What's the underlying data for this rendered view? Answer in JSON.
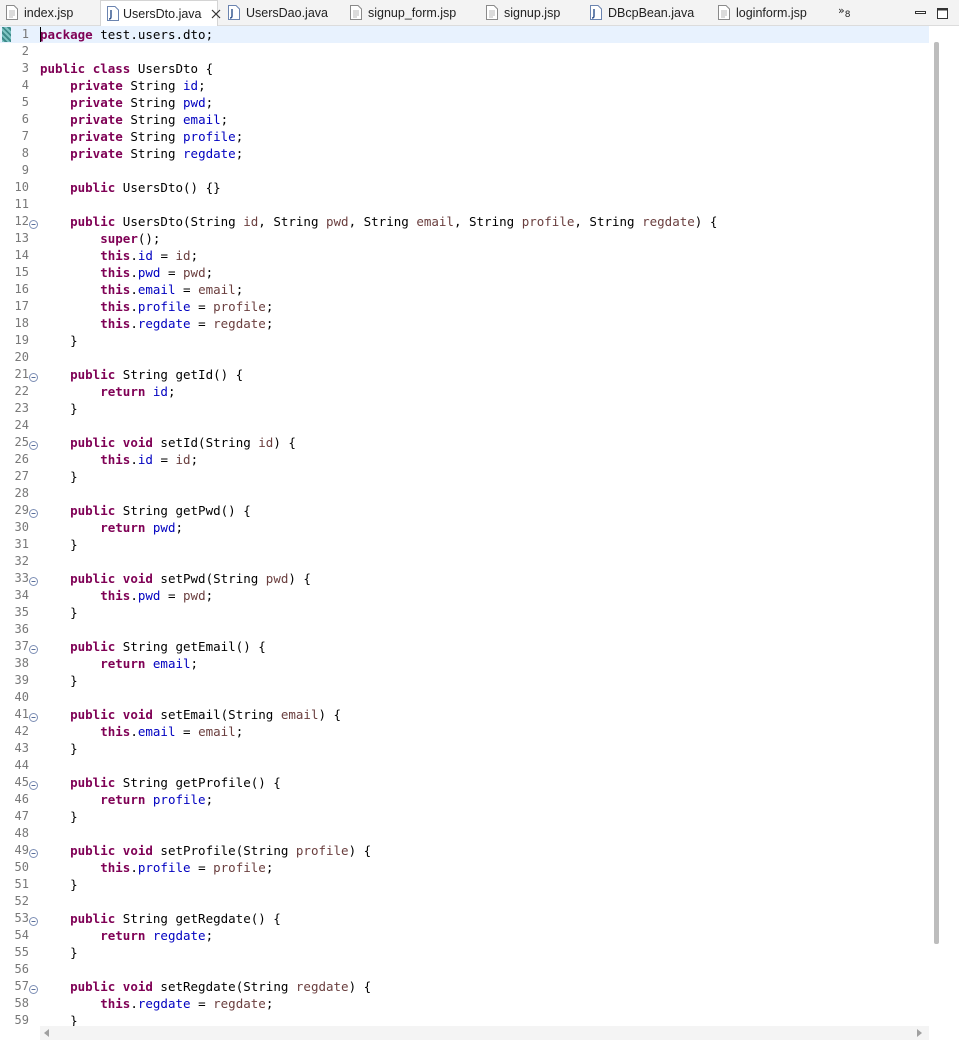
{
  "tabs": [
    {
      "label": "index.jsp",
      "type": "jsp",
      "active": false
    },
    {
      "label": "UsersDto.java",
      "type": "java",
      "active": true
    },
    {
      "label": "UsersDao.java",
      "type": "java",
      "active": false
    },
    {
      "label": "signup_form.jsp",
      "type": "jsp",
      "active": false
    },
    {
      "label": "signup.jsp",
      "type": "jsp",
      "active": false
    },
    {
      "label": "DBcpBean.java",
      "type": "java",
      "active": false
    },
    {
      "label": "loginform.jsp",
      "type": "jsp",
      "active": false
    }
  ],
  "overflow": {
    "symbol": "»",
    "count": "8"
  },
  "icons": {
    "file": "file-icon",
    "close": "close-icon",
    "minimize": "minimize-icon",
    "maximize": "maximize-icon",
    "fold": "fold-collapse-icon"
  },
  "colors": {
    "keyword": "#7f0055",
    "field": "#0000c0",
    "param": "#6a3e3e",
    "line_number": "#787878",
    "current_line": "#e8f2fe"
  },
  "editor": {
    "current_line": 1,
    "lines": [
      [
        [
          "package",
          "kw"
        ],
        [
          " test.users.dto;",
          ""
        ]
      ],
      [],
      [
        [
          "public",
          "kw"
        ],
        [
          " ",
          ""
        ],
        [
          "class",
          "kw"
        ],
        [
          " UsersDto {",
          ""
        ]
      ],
      [
        [
          "    ",
          ""
        ],
        [
          "private",
          "kw"
        ],
        [
          " String ",
          ""
        ],
        [
          "id",
          "fd"
        ],
        [
          ";",
          ""
        ]
      ],
      [
        [
          "    ",
          ""
        ],
        [
          "private",
          "kw"
        ],
        [
          " String ",
          ""
        ],
        [
          "pwd",
          "fd"
        ],
        [
          ";",
          ""
        ]
      ],
      [
        [
          "    ",
          ""
        ],
        [
          "private",
          "kw"
        ],
        [
          " String ",
          ""
        ],
        [
          "email",
          "fd"
        ],
        [
          ";",
          ""
        ]
      ],
      [
        [
          "    ",
          ""
        ],
        [
          "private",
          "kw"
        ],
        [
          " String ",
          ""
        ],
        [
          "profile",
          "fd"
        ],
        [
          ";",
          ""
        ]
      ],
      [
        [
          "    ",
          ""
        ],
        [
          "private",
          "kw"
        ],
        [
          " String ",
          ""
        ],
        [
          "regdate",
          "fd"
        ],
        [
          ";",
          ""
        ]
      ],
      [],
      [
        [
          "    ",
          ""
        ],
        [
          "public",
          "kw"
        ],
        [
          " UsersDto() {}",
          ""
        ]
      ],
      [],
      [
        [
          "    ",
          ""
        ],
        [
          "public",
          "kw"
        ],
        [
          " UsersDto(String ",
          ""
        ],
        [
          "id",
          "pm"
        ],
        [
          ", String ",
          ""
        ],
        [
          "pwd",
          "pm"
        ],
        [
          ", String ",
          ""
        ],
        [
          "email",
          "pm"
        ],
        [
          ", String ",
          ""
        ],
        [
          "profile",
          "pm"
        ],
        [
          ", String ",
          ""
        ],
        [
          "regdate",
          "pm"
        ],
        [
          ") {",
          ""
        ]
      ],
      [
        [
          "        ",
          ""
        ],
        [
          "super",
          "kw"
        ],
        [
          "();",
          ""
        ]
      ],
      [
        [
          "        ",
          ""
        ],
        [
          "this",
          "kw"
        ],
        [
          ".",
          ""
        ],
        [
          "id",
          "fd"
        ],
        [
          " = ",
          ""
        ],
        [
          "id",
          "pm"
        ],
        [
          ";",
          ""
        ]
      ],
      [
        [
          "        ",
          ""
        ],
        [
          "this",
          "kw"
        ],
        [
          ".",
          ""
        ],
        [
          "pwd",
          "fd"
        ],
        [
          " = ",
          ""
        ],
        [
          "pwd",
          "pm"
        ],
        [
          ";",
          ""
        ]
      ],
      [
        [
          "        ",
          ""
        ],
        [
          "this",
          "kw"
        ],
        [
          ".",
          ""
        ],
        [
          "email",
          "fd"
        ],
        [
          " = ",
          ""
        ],
        [
          "email",
          "pm"
        ],
        [
          ";",
          ""
        ]
      ],
      [
        [
          "        ",
          ""
        ],
        [
          "this",
          "kw"
        ],
        [
          ".",
          ""
        ],
        [
          "profile",
          "fd"
        ],
        [
          " = ",
          ""
        ],
        [
          "profile",
          "pm"
        ],
        [
          ";",
          ""
        ]
      ],
      [
        [
          "        ",
          ""
        ],
        [
          "this",
          "kw"
        ],
        [
          ".",
          ""
        ],
        [
          "regdate",
          "fd"
        ],
        [
          " = ",
          ""
        ],
        [
          "regdate",
          "pm"
        ],
        [
          ";",
          ""
        ]
      ],
      [
        [
          "    }",
          ""
        ]
      ],
      [],
      [
        [
          "    ",
          ""
        ],
        [
          "public",
          "kw"
        ],
        [
          " String getId() {",
          ""
        ]
      ],
      [
        [
          "        ",
          ""
        ],
        [
          "return",
          "kw"
        ],
        [
          " ",
          ""
        ],
        [
          "id",
          "fd"
        ],
        [
          ";",
          ""
        ]
      ],
      [
        [
          "    }",
          ""
        ]
      ],
      [],
      [
        [
          "    ",
          ""
        ],
        [
          "public",
          "kw"
        ],
        [
          " ",
          ""
        ],
        [
          "void",
          "kw"
        ],
        [
          " setId(String ",
          ""
        ],
        [
          "id",
          "pm"
        ],
        [
          ") {",
          ""
        ]
      ],
      [
        [
          "        ",
          ""
        ],
        [
          "this",
          "kw"
        ],
        [
          ".",
          ""
        ],
        [
          "id",
          "fd"
        ],
        [
          " = ",
          ""
        ],
        [
          "id",
          "pm"
        ],
        [
          ";",
          ""
        ]
      ],
      [
        [
          "    }",
          ""
        ]
      ],
      [],
      [
        [
          "    ",
          ""
        ],
        [
          "public",
          "kw"
        ],
        [
          " String getPwd() {",
          ""
        ]
      ],
      [
        [
          "        ",
          ""
        ],
        [
          "return",
          "kw"
        ],
        [
          " ",
          ""
        ],
        [
          "pwd",
          "fd"
        ],
        [
          ";",
          ""
        ]
      ],
      [
        [
          "    }",
          ""
        ]
      ],
      [],
      [
        [
          "    ",
          ""
        ],
        [
          "public",
          "kw"
        ],
        [
          " ",
          ""
        ],
        [
          "void",
          "kw"
        ],
        [
          " setPwd(String ",
          ""
        ],
        [
          "pwd",
          "pm"
        ],
        [
          ") {",
          ""
        ]
      ],
      [
        [
          "        ",
          ""
        ],
        [
          "this",
          "kw"
        ],
        [
          ".",
          ""
        ],
        [
          "pwd",
          "fd"
        ],
        [
          " = ",
          ""
        ],
        [
          "pwd",
          "pm"
        ],
        [
          ";",
          ""
        ]
      ],
      [
        [
          "    }",
          ""
        ]
      ],
      [],
      [
        [
          "    ",
          ""
        ],
        [
          "public",
          "kw"
        ],
        [
          " String getEmail() {",
          ""
        ]
      ],
      [
        [
          "        ",
          ""
        ],
        [
          "return",
          "kw"
        ],
        [
          " ",
          ""
        ],
        [
          "email",
          "fd"
        ],
        [
          ";",
          ""
        ]
      ],
      [
        [
          "    }",
          ""
        ]
      ],
      [],
      [
        [
          "    ",
          ""
        ],
        [
          "public",
          "kw"
        ],
        [
          " ",
          ""
        ],
        [
          "void",
          "kw"
        ],
        [
          " setEmail(String ",
          ""
        ],
        [
          "email",
          "pm"
        ],
        [
          ") {",
          ""
        ]
      ],
      [
        [
          "        ",
          ""
        ],
        [
          "this",
          "kw"
        ],
        [
          ".",
          ""
        ],
        [
          "email",
          "fd"
        ],
        [
          " = ",
          ""
        ],
        [
          "email",
          "pm"
        ],
        [
          ";",
          ""
        ]
      ],
      [
        [
          "    }",
          ""
        ]
      ],
      [],
      [
        [
          "    ",
          ""
        ],
        [
          "public",
          "kw"
        ],
        [
          " String getProfile() {",
          ""
        ]
      ],
      [
        [
          "        ",
          ""
        ],
        [
          "return",
          "kw"
        ],
        [
          " ",
          ""
        ],
        [
          "profile",
          "fd"
        ],
        [
          ";",
          ""
        ]
      ],
      [
        [
          "    }",
          ""
        ]
      ],
      [],
      [
        [
          "    ",
          ""
        ],
        [
          "public",
          "kw"
        ],
        [
          " ",
          ""
        ],
        [
          "void",
          "kw"
        ],
        [
          " setProfile(String ",
          ""
        ],
        [
          "profile",
          "pm"
        ],
        [
          ") {",
          ""
        ]
      ],
      [
        [
          "        ",
          ""
        ],
        [
          "this",
          "kw"
        ],
        [
          ".",
          ""
        ],
        [
          "profile",
          "fd"
        ],
        [
          " = ",
          ""
        ],
        [
          "profile",
          "pm"
        ],
        [
          ";",
          ""
        ]
      ],
      [
        [
          "    }",
          ""
        ]
      ],
      [],
      [
        [
          "    ",
          ""
        ],
        [
          "public",
          "kw"
        ],
        [
          " String getRegdate() {",
          ""
        ]
      ],
      [
        [
          "        ",
          ""
        ],
        [
          "return",
          "kw"
        ],
        [
          " ",
          ""
        ],
        [
          "regdate",
          "fd"
        ],
        [
          ";",
          ""
        ]
      ],
      [
        [
          "    }",
          ""
        ]
      ],
      [],
      [
        [
          "    ",
          ""
        ],
        [
          "public",
          "kw"
        ],
        [
          " ",
          ""
        ],
        [
          "void",
          "kw"
        ],
        [
          " setRegdate(String ",
          ""
        ],
        [
          "regdate",
          "pm"
        ],
        [
          ") {",
          ""
        ]
      ],
      [
        [
          "        ",
          ""
        ],
        [
          "this",
          "kw"
        ],
        [
          ".",
          ""
        ],
        [
          "regdate",
          "fd"
        ],
        [
          " = ",
          ""
        ],
        [
          "regdate",
          "pm"
        ],
        [
          ";",
          ""
        ]
      ],
      [
        [
          "    }",
          ""
        ]
      ]
    ],
    "fold_lines": [
      12,
      21,
      25,
      29,
      33,
      37,
      41,
      45,
      49,
      53,
      57
    ]
  }
}
